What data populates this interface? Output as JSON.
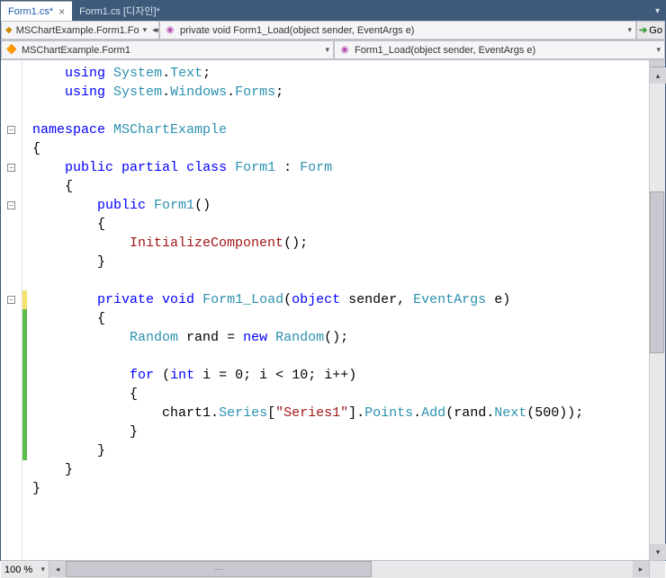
{
  "tabs": [
    {
      "label": "Form1.cs*",
      "active": true
    },
    {
      "label": "Form1.cs [디자인]*",
      "active": false
    }
  ],
  "nav": {
    "class_dropdown": "MSChartExample.Form1.Fo",
    "member_dropdown": "private void Form1_Load(object sender, EventArgs e)",
    "breadcrumb_class": "MSChartExample.Form1",
    "breadcrumb_member": "Form1_Load(object sender, EventArgs e)",
    "go_label": "Go"
  },
  "code": {
    "lines": [
      {
        "indent": 1,
        "fold": null,
        "tokens": [
          [
            "kw",
            "using"
          ],
          [
            "",
            ""
          ],
          [
            "type",
            "System"
          ],
          [
            "punct",
            "."
          ],
          [
            "type",
            "Text"
          ],
          [
            "punct",
            ";"
          ]
        ]
      },
      {
        "indent": 1,
        "fold": null,
        "tokens": [
          [
            "kw",
            "using"
          ],
          [
            "",
            ""
          ],
          [
            "type",
            "System"
          ],
          [
            "punct",
            "."
          ],
          [
            "type",
            "Windows"
          ],
          [
            "punct",
            "."
          ],
          [
            "type",
            "Forms"
          ],
          [
            "punct",
            ";"
          ]
        ]
      },
      {
        "indent": 0,
        "fold": null,
        "tokens": []
      },
      {
        "indent": 0,
        "fold": "-",
        "tokens": [
          [
            "kw",
            "namespace"
          ],
          [
            "",
            ""
          ],
          [
            "type",
            "MSChartExample"
          ]
        ]
      },
      {
        "indent": 0,
        "fold": null,
        "tokens": [
          [
            "punct",
            "{"
          ]
        ]
      },
      {
        "indent": 1,
        "fold": "-",
        "tokens": [
          [
            "kw",
            "public"
          ],
          [
            "",
            ""
          ],
          [
            "kw",
            "partial"
          ],
          [
            "",
            ""
          ],
          [
            "kw",
            "class"
          ],
          [
            "",
            ""
          ],
          [
            "type",
            "Form1"
          ],
          [
            "",
            ""
          ],
          [
            "punct",
            ":"
          ],
          [
            "",
            ""
          ],
          [
            "type",
            "Form"
          ]
        ]
      },
      {
        "indent": 1,
        "fold": null,
        "tokens": [
          [
            "punct",
            "{"
          ]
        ]
      },
      {
        "indent": 2,
        "fold": "-",
        "tokens": [
          [
            "kw",
            "public"
          ],
          [
            "",
            ""
          ],
          [
            "type",
            "Form1"
          ],
          [
            "paren",
            "()"
          ]
        ]
      },
      {
        "indent": 2,
        "fold": null,
        "tokens": [
          [
            "punct",
            "{"
          ]
        ]
      },
      {
        "indent": 3,
        "fold": null,
        "tokens": [
          [
            "method",
            "InitializeComponent"
          ],
          [
            "paren",
            "();"
          ]
        ]
      },
      {
        "indent": 2,
        "fold": null,
        "tokens": [
          [
            "punct",
            "}"
          ]
        ]
      },
      {
        "indent": 0,
        "fold": null,
        "tokens": []
      },
      {
        "indent": 2,
        "fold": "-",
        "mark": "yellow",
        "tokens": [
          [
            "kw",
            "private"
          ],
          [
            "",
            ""
          ],
          [
            "kw",
            "void"
          ],
          [
            "",
            ""
          ],
          [
            "type",
            "Form1_Load"
          ],
          [
            "paren",
            "("
          ],
          [
            "kw",
            "object"
          ],
          [
            "",
            ""
          ],
          [
            "",
            "sender"
          ],
          [
            "punct",
            ","
          ],
          [
            "",
            ""
          ],
          [
            "type",
            "EventArgs"
          ],
          [
            "",
            ""
          ],
          [
            "",
            "e"
          ],
          [
            "paren",
            ")"
          ]
        ]
      },
      {
        "indent": 2,
        "fold": null,
        "mark": "green",
        "tokens": [
          [
            "punct",
            "{"
          ]
        ]
      },
      {
        "indent": 3,
        "fold": null,
        "mark": "green",
        "tokens": [
          [
            "type",
            "Random"
          ],
          [
            "",
            ""
          ],
          [
            "",
            "rand"
          ],
          [
            "",
            ""
          ],
          [
            "punct",
            "="
          ],
          [
            "",
            ""
          ],
          [
            "kw",
            "new"
          ],
          [
            "",
            ""
          ],
          [
            "type",
            "Random"
          ],
          [
            "paren",
            "();"
          ]
        ]
      },
      {
        "indent": 0,
        "fold": null,
        "mark": "green",
        "tokens": []
      },
      {
        "indent": 3,
        "fold": null,
        "mark": "green",
        "tokens": [
          [
            "kw",
            "for"
          ],
          [
            "",
            ""
          ],
          [
            "paren",
            "("
          ],
          [
            "kw",
            "int"
          ],
          [
            "",
            ""
          ],
          [
            "",
            "i"
          ],
          [
            "",
            ""
          ],
          [
            "punct",
            "="
          ],
          [
            "",
            ""
          ],
          [
            "",
            "0"
          ],
          [
            "punct",
            ";"
          ],
          [
            "",
            ""
          ],
          [
            "",
            "i"
          ],
          [
            "",
            ""
          ],
          [
            "punct",
            "<"
          ],
          [
            "",
            ""
          ],
          [
            "",
            "10"
          ],
          [
            "punct",
            ";"
          ],
          [
            "",
            ""
          ],
          [
            "",
            "i"
          ],
          [
            "punct",
            "++)"
          ]
        ]
      },
      {
        "indent": 3,
        "fold": null,
        "mark": "green",
        "tokens": [
          [
            "punct",
            "{"
          ]
        ]
      },
      {
        "indent": 4,
        "fold": null,
        "mark": "green",
        "tokens": [
          [
            "",
            "chart1"
          ],
          [
            "punct",
            "."
          ],
          [
            "type",
            "Series"
          ],
          [
            "punct",
            "["
          ],
          [
            "str",
            "\"Series1\""
          ],
          [
            "punct",
            "]"
          ],
          [
            "punct",
            "."
          ],
          [
            "type",
            "Points"
          ],
          [
            "punct",
            "."
          ],
          [
            "type",
            "Add"
          ],
          [
            "paren",
            "("
          ],
          [
            "",
            "rand"
          ],
          [
            "punct",
            "."
          ],
          [
            "type",
            "Next"
          ],
          [
            "paren",
            "("
          ],
          [
            "",
            "500"
          ],
          [
            "paren",
            "));"
          ]
        ]
      },
      {
        "indent": 3,
        "fold": null,
        "mark": "green",
        "tokens": [
          [
            "punct",
            "}"
          ]
        ]
      },
      {
        "indent": 2,
        "fold": null,
        "mark": "green",
        "tokens": [
          [
            "punct",
            "}"
          ]
        ]
      },
      {
        "indent": 1,
        "fold": null,
        "tokens": [
          [
            "punct",
            "}"
          ]
        ]
      },
      {
        "indent": 0,
        "fold": null,
        "tokens": [
          [
            "punct",
            "}"
          ]
        ]
      }
    ]
  },
  "zoom": "100 %"
}
